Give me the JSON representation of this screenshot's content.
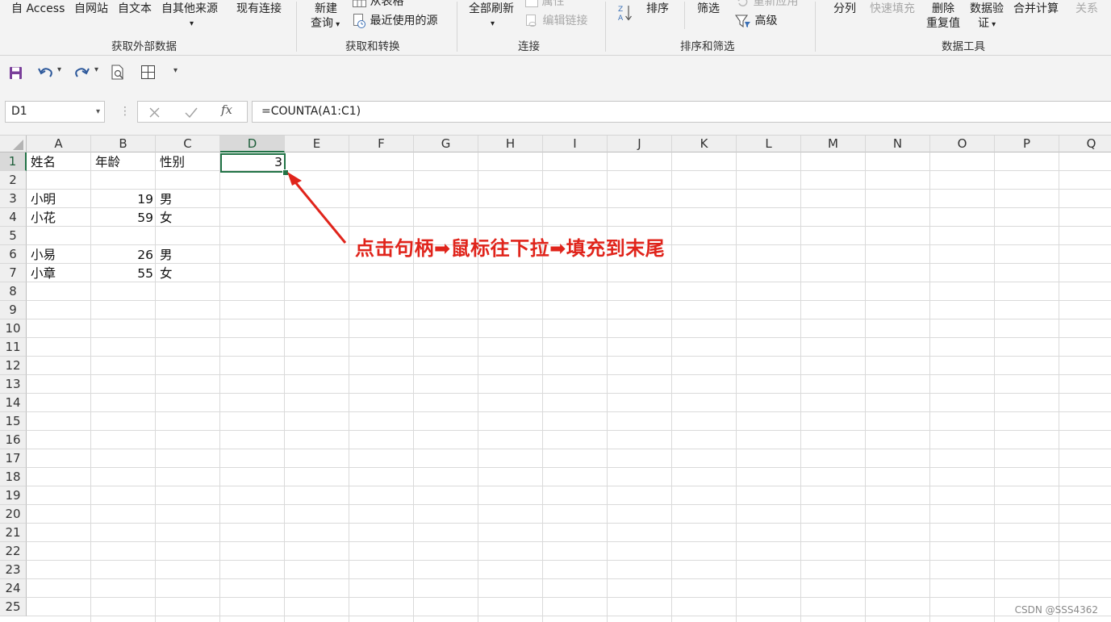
{
  "ribbon": {
    "groups": {
      "external_data": {
        "label": "获取外部数据",
        "from_access": "自 Access",
        "from_web": "自网站",
        "from_text": "自文本",
        "from_other": "自其他来源",
        "existing_connections": "现有连接"
      },
      "get_transform": {
        "label": "获取和转换",
        "new_query_line1": "新建",
        "new_query_line2": "查询",
        "from_table": "从表格",
        "recent_sources": "最近使用的源"
      },
      "connections": {
        "label": "连接",
        "refresh_all": "全部刷新",
        "properties": "属性",
        "edit_links": "编辑链接"
      },
      "sort_filter": {
        "label": "排序和筛选",
        "sort": "排序",
        "filter": "筛选",
        "reapply": "重新应用",
        "advanced": "高级"
      },
      "data_tools": {
        "label": "数据工具",
        "text_to_columns": "分列",
        "flash_fill": "快速填充",
        "remove_dup_line1": "删除",
        "remove_dup_line2": "重复值",
        "validation_line1": "数据验",
        "validation_line2": "证",
        "consolidate": "合并计算",
        "relationships": "关系"
      }
    }
  },
  "qat": {
    "icons": [
      "save-icon",
      "undo-icon",
      "redo-icon",
      "print-preview-icon",
      "borders-icon",
      "customize-icon"
    ]
  },
  "formula_bar": {
    "name_box": "D1",
    "fx": "fx",
    "formula": "=COUNTA(A1:C1)"
  },
  "sheet": {
    "columns": [
      "A",
      "B",
      "C",
      "D",
      "E",
      "F",
      "G",
      "H",
      "I",
      "J",
      "K",
      "L",
      "M",
      "N",
      "O",
      "P",
      "Q"
    ],
    "rows": [
      "1",
      "2",
      "3",
      "4",
      "5",
      "6",
      "7",
      "8",
      "9",
      "10",
      "11",
      "12",
      "13",
      "14",
      "15",
      "16",
      "17",
      "18",
      "19",
      "20",
      "21",
      "22",
      "23",
      "24",
      "25"
    ],
    "active_cell": "D1",
    "cells": {
      "A1": "姓名",
      "B1": "年龄",
      "C1": "性别",
      "D1": "3",
      "A3": "小明",
      "B3": "19",
      "C3": "男",
      "A4": "小花",
      "B4": "59",
      "C4": "女",
      "A6": "小易",
      "B6": "26",
      "C6": "男",
      "A7": "小章",
      "B7": "55",
      "C7": "女"
    }
  },
  "annotation": {
    "text": "点击句柄➡鼠标往下拉➡填充到末尾",
    "color": "#e0241b"
  },
  "watermark": "CSDN @SSS4362",
  "colors": {
    "accent": "#217346",
    "ribbon_bg": "#f3f3f3",
    "annotation": "#e0241b"
  }
}
